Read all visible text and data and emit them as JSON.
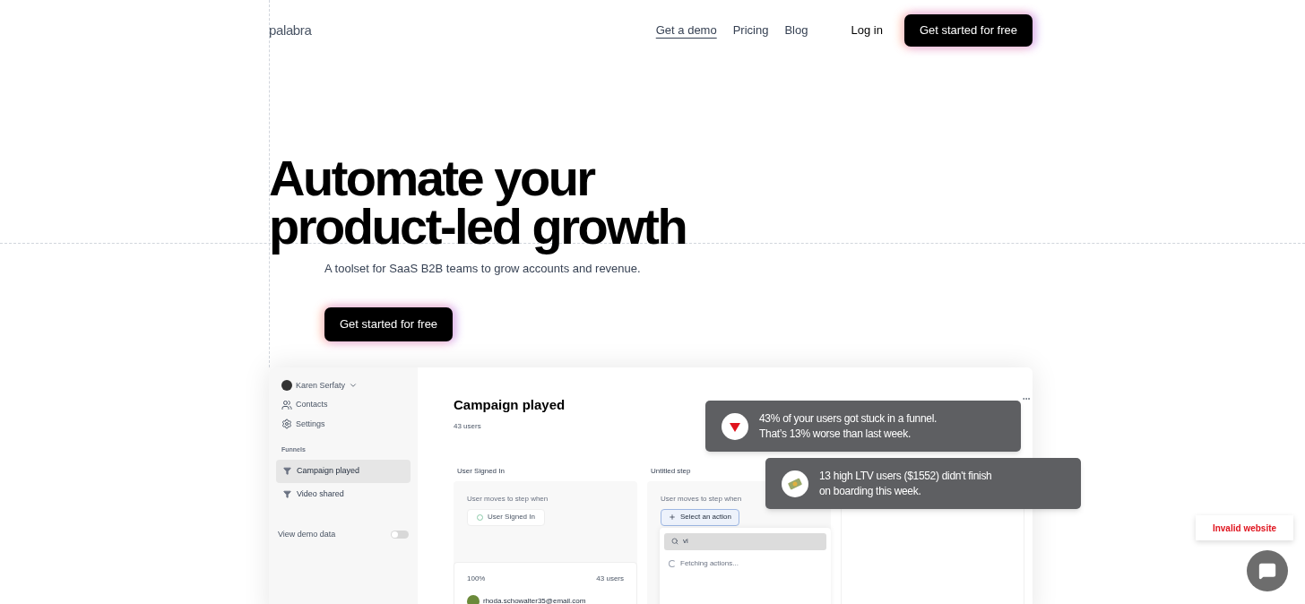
{
  "header": {
    "logo": "palabra",
    "nav": [
      {
        "label": "Get a demo",
        "selected": true
      },
      {
        "label": "Pricing",
        "selected": false
      },
      {
        "label": "Blog",
        "selected": false
      }
    ],
    "login": "Log in",
    "cta": "Get started for free"
  },
  "hero": {
    "title_lines": [
      "Automate your",
      "product-led growth"
    ],
    "subtitle": "A toolset for SaaS B2B teams to grow accounts and revenue.",
    "cta": "Get started for free"
  },
  "app": {
    "user": "Karen Serfaty",
    "menu": [
      {
        "label": "Contacts",
        "kind": "contacts"
      },
      {
        "label": "Settings",
        "kind": "settings"
      }
    ],
    "funnels_heading": "Funnels",
    "funnels": [
      {
        "label": "Campaign played",
        "selected": true
      },
      {
        "label": "Video shared",
        "selected": false
      }
    ],
    "demo_toggle": {
      "label": "View demo data",
      "on": false
    },
    "title": "Campaign played",
    "count": "43 users",
    "steps": [
      {
        "title": "User Signed In",
        "hint": "User moves to step when",
        "action": "User Signed In",
        "kind": "event"
      },
      {
        "title": "Untitled step",
        "hint": "User moves to step when",
        "action": "Select an action",
        "kind": "select"
      }
    ],
    "result": {
      "percent": "100%",
      "users": "43 users",
      "email": "rhoda.schowalter35@email.com"
    },
    "dropdown": {
      "query": "vi",
      "status": "Fetching actions..."
    }
  },
  "notifications": [
    {
      "kind": "down",
      "lines": [
        "43% of your users got stuck in a funnel.",
        "That’s 13% worse than last week."
      ]
    },
    {
      "kind": "money",
      "lines": [
        "13 high LTV users ($1552) didn't finish",
        "on boarding this week."
      ]
    }
  ],
  "badge": "Invalid website"
}
